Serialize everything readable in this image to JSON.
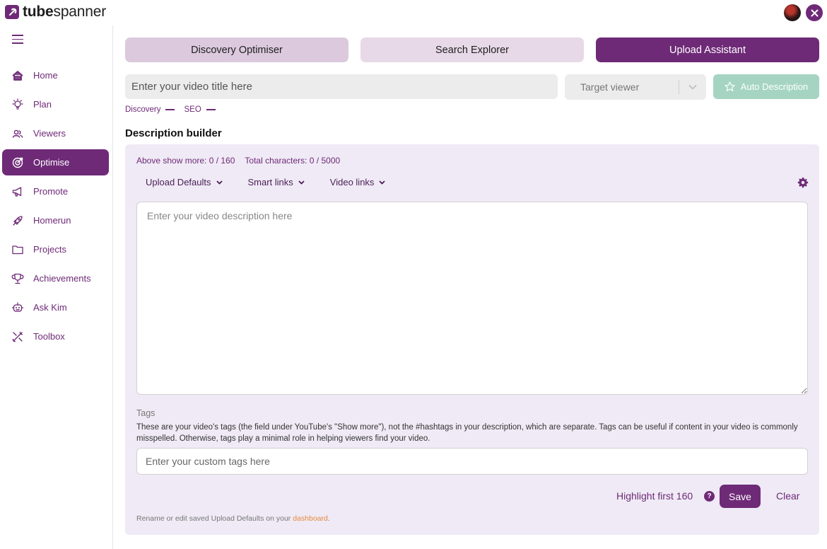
{
  "app": {
    "brand_bold": "tube",
    "brand_regular": "spanner"
  },
  "sidebar": {
    "items": [
      {
        "label": "Home",
        "icon": "home-icon",
        "active": false
      },
      {
        "label": "Plan",
        "icon": "lightbulb-icon",
        "active": false
      },
      {
        "label": "Viewers",
        "icon": "users-icon",
        "active": false
      },
      {
        "label": "Optimise",
        "icon": "target-icon",
        "active": true
      },
      {
        "label": "Promote",
        "icon": "megaphone-icon",
        "active": false
      },
      {
        "label": "Homerun",
        "icon": "rocket-icon",
        "active": false
      },
      {
        "label": "Projects",
        "icon": "folder-icon",
        "active": false
      },
      {
        "label": "Achievements",
        "icon": "trophy-icon",
        "active": false
      },
      {
        "label": "Ask Kim",
        "icon": "robot-icon",
        "active": false
      },
      {
        "label": "Toolbox",
        "icon": "tools-icon",
        "active": false
      }
    ]
  },
  "tabs": [
    {
      "label": "Discovery Optimiser",
      "active": false
    },
    {
      "label": "Search Explorer",
      "active": false
    },
    {
      "label": "Upload Assistant",
      "active": true
    }
  ],
  "toolbar": {
    "title_placeholder": "Enter your video title here",
    "target_viewer": "Target viewer",
    "auto_description": "Auto Description"
  },
  "breadcrumbs": [
    "Discovery",
    "SEO"
  ],
  "builder": {
    "title": "Description builder",
    "above_show_more": "Above show more: 0 / 160",
    "total_characters": "Total characters: 0 / 5000",
    "menus": [
      "Upload Defaults",
      "Smart links",
      "Video links"
    ],
    "description_placeholder": "Enter your video description here",
    "tags_label": "Tags",
    "tags_help": "These are your video's tags (the field under YouTube's \"Show more\"), not the #hashtags in your description, which are separate. Tags can be useful if content in your video is commonly misspelled. Otherwise, tags play a minimal role in helping viewers find your video.",
    "tags_placeholder": "Enter your custom tags here",
    "highlight_label": "Highlight first 160",
    "save_label": "Save",
    "clear_label": "Clear",
    "footnote_prefix": "Rename or edit saved Upload Defaults on your ",
    "footnote_link": "dashboard",
    "footnote_suffix": "."
  },
  "colors": {
    "accent": "#6e2a77",
    "tab_inactive": "#e7d9e8",
    "panel_bg": "#efeaf5",
    "auto_button": "#a5d5c2",
    "link": "#e98a3c"
  }
}
